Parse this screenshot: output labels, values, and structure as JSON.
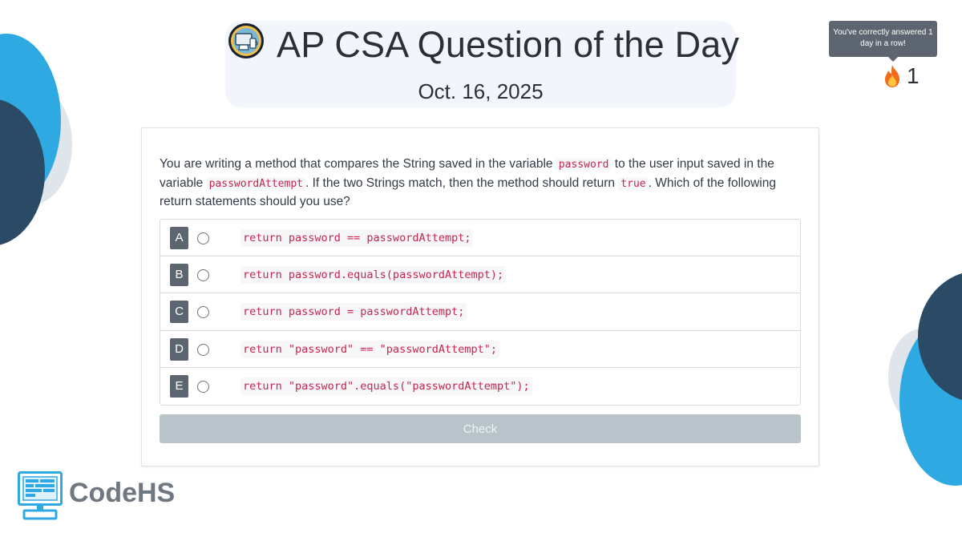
{
  "header": {
    "title": "AP CSA Question of the Day",
    "date": "Oct. 16, 2025"
  },
  "streak": {
    "tooltip": "You've correctly answered 1 day in a row!",
    "count": "1",
    "icon": "fire-icon"
  },
  "question": {
    "parts": [
      "You are writing a method that compares the String saved in the variable ",
      "password",
      " to the user input saved in the variable ",
      "passwordAttempt",
      ". If the two Strings match, then the method should return ",
      "true",
      ". Which of the following return statements should you use?"
    ]
  },
  "options": [
    {
      "letter": "A",
      "code": "return password == passwordAttempt;",
      "selected": false
    },
    {
      "letter": "B",
      "code": "return password.equals(passwordAttempt);",
      "selected": false
    },
    {
      "letter": "C",
      "code": "return password = passwordAttempt;",
      "selected": false
    },
    {
      "letter": "D",
      "code": "return \"password\" == \"passwordAttempt\";",
      "selected": false
    },
    {
      "letter": "E",
      "code": "return \"password\".equals(\"passwordAttempt\");",
      "selected": false
    }
  ],
  "check_button": {
    "label": "Check",
    "enabled": false
  },
  "brand": {
    "name": "CodeHS"
  },
  "colors": {
    "code_text": "#c7254e",
    "letter_badge": "#5d6670",
    "check_disabled": "#b9c4ca",
    "deco_blue": "#2aa9e0",
    "deco_navy": "#2b4a66"
  }
}
